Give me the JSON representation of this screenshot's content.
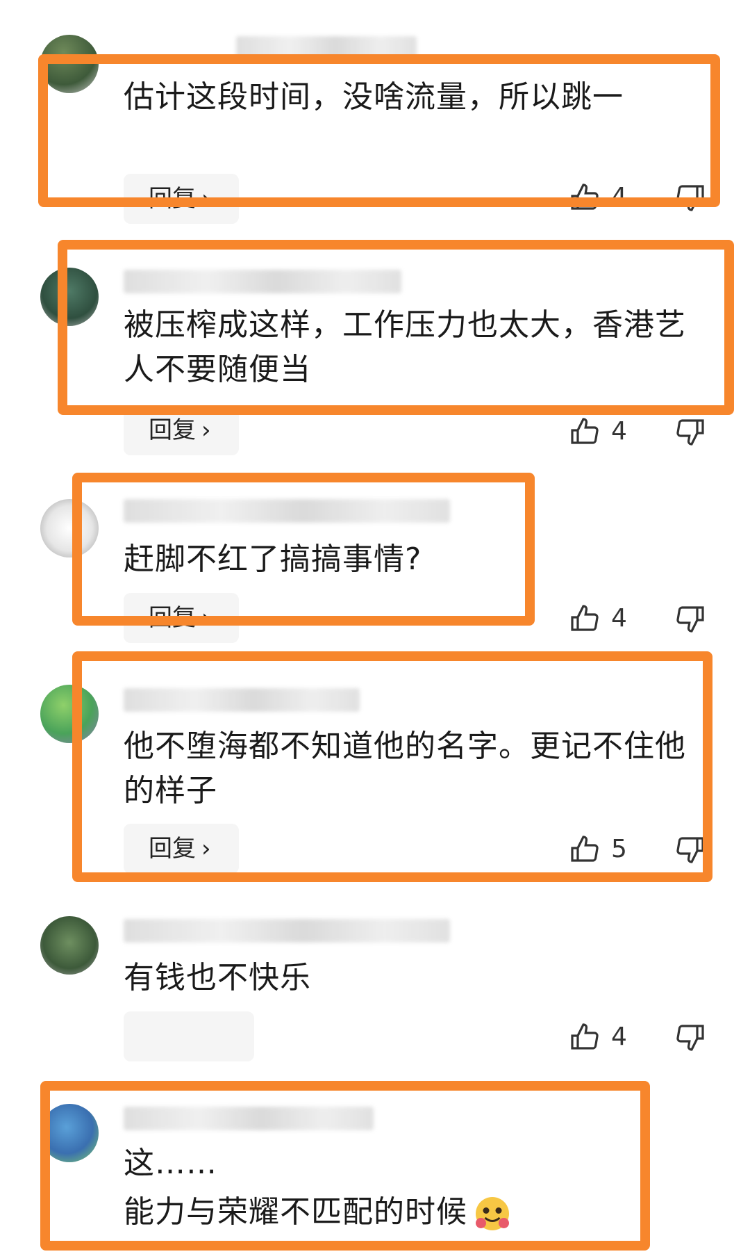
{
  "comments": [
    {
      "text": "估计这段时间，没啥流量，所以跳一",
      "reply_label": "回复",
      "likes": "4"
    },
    {
      "text": "被压榨成这样，工作压力也太大，香港艺人不要随便当",
      "reply_label": "回复",
      "likes": "4"
    },
    {
      "text": "赶脚不红了搞搞事情?",
      "reply_label": "回复",
      "likes": "4"
    },
    {
      "text": "他不堕海都不知道他的名字。更记不住他的样子",
      "reply_label": "回复",
      "likes": "5"
    },
    {
      "text": "有钱也不快乐",
      "likes": "4"
    },
    {
      "text_line1": "这……",
      "text_line2": "能力与荣耀不匹配的时候"
    }
  ],
  "icons": {
    "like": "thumbs-up-icon",
    "dislike": "thumbs-down-icon",
    "reply_chevron": "chevron-right-icon",
    "emoji": "hugging-face-emoji"
  },
  "highlight_color": "#f7862c"
}
